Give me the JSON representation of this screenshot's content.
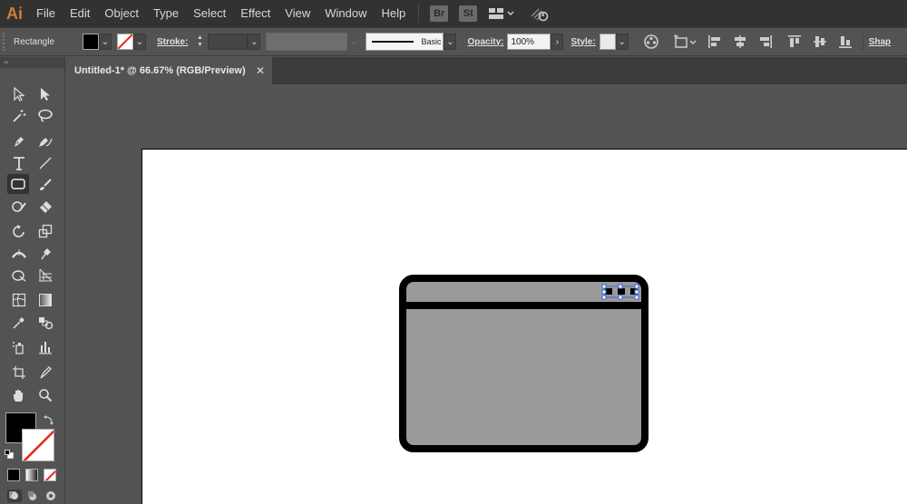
{
  "app": {
    "logo": "Ai"
  },
  "menu": [
    "File",
    "Edit",
    "Object",
    "Type",
    "Select",
    "Effect",
    "View",
    "Window",
    "Help"
  ],
  "menu_badges": [
    "Br",
    "St"
  ],
  "control": {
    "tool_name": "Rectangle",
    "stroke_label": "Stroke:",
    "stroke_profile": "Basic",
    "opacity_label": "Opacity:",
    "opacity_value": "100%",
    "style_label": "Style:",
    "shape_label": "Shap"
  },
  "document": {
    "tab_title": "Untitled-1* @ 66.67% (RGB/Preview)",
    "close": "✕"
  },
  "toolbox_header": "‹‹",
  "colors": {
    "accent": "#d37e36",
    "ui_dark": "#323232",
    "panel": "#535353",
    "shape_fill": "#9a9a9a",
    "selection": "#3d6bd4"
  }
}
